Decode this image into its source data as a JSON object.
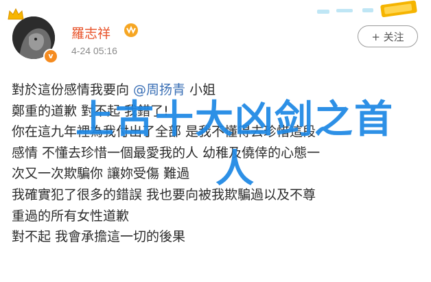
{
  "post": {
    "username": "羅志祥",
    "timestamp": "4-24 05:16",
    "follow_label": "+ 关注",
    "verify_mark": "v",
    "lines": [
      {
        "before": "對於這份感情我要向 ",
        "mention": "@周扬青",
        "after": " 小姐"
      },
      {
        "text": "鄭重的道歉 對不起 我錯了!"
      },
      {
        "text": "你在這九年裡為我付出了全部 是我不懂得去珍惜這段"
      },
      {
        "text": "感情 不懂去珍惜一個最愛我的人 幼稚及僥倖的心態一"
      },
      {
        "text": "次又一次欺騙你 讓妳受傷 難過"
      },
      {
        "text": "我確實犯了很多的錯誤 我也要向被我欺騙過以及不尊"
      },
      {
        "text": "重過的所有女性道歉"
      },
      {
        "text": "對不起   我會承擔這一切的後果"
      }
    ]
  },
  "overlay": {
    "line1": "上古十大凶剑之首",
    "line2": "人"
  },
  "colors": {
    "username": "#e8532a",
    "mention": "#3a6fb5",
    "overlay": "#1e88e5",
    "timestamp": "#8a8a8a"
  },
  "icons": [
    "crown-icon",
    "vip-badge-icon",
    "verified-icon",
    "top-decoration-icon"
  ]
}
